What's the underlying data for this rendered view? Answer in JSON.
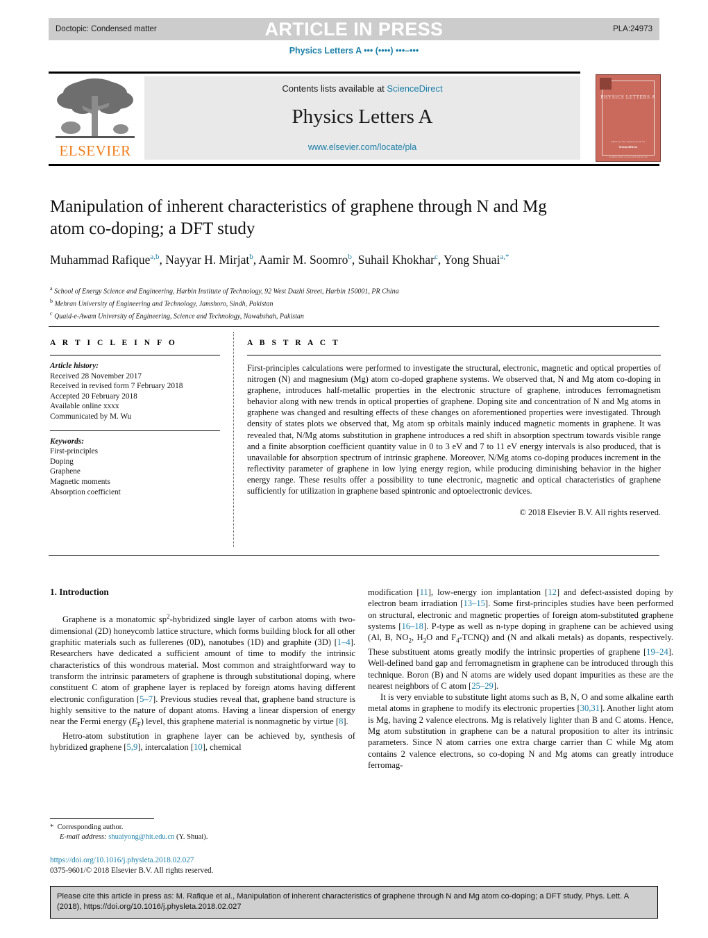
{
  "press_bar": {
    "doctopic": "Doctopic: Condensed matter",
    "status": "ARTICLE IN PRESS",
    "code": "PLA:24973"
  },
  "running_head": "Physics Letters A ••• (••••) •••–•••",
  "masthead": {
    "contents_prefix": "Contents lists available at ",
    "contents_link": "ScienceDirect",
    "journal_name": "Physics Letters A",
    "journal_url": "www.elsevier.com/locate/pla",
    "publisher_logo_text": "ELSEVIER",
    "cover": {
      "title": "PHYSICS LETTERS A",
      "foot1": "Edited by: V.M. Agranovich, M. Wu",
      "foot2": "ScienceDirect",
      "foot3": "Available online at www.sciencedirect.com"
    }
  },
  "article": {
    "title": "Manipulation of inherent characteristics of graphene through N and Mg atom co-doping; a DFT study",
    "authors": [
      {
        "name": "Muhammad Rafique",
        "marks": "a,b",
        "sep": ", "
      },
      {
        "name": "Nayyar H. Mirjat",
        "marks": "b",
        "sep": ", "
      },
      {
        "name": "Aamir M. Soomro",
        "marks": "b",
        "sep": ", "
      },
      {
        "name": "Suhail Khokhar",
        "marks": "c",
        "sep": ", "
      },
      {
        "name": "Yong Shuai",
        "marks": "a,*",
        "sep": ""
      }
    ],
    "affiliations": [
      {
        "mark": "a",
        "text": "School of Energy Science and Engineering, Harbin Institute of Technology, 92 West Dazhi Street, Harbin 150001, PR China"
      },
      {
        "mark": "b",
        "text": "Mehran University of Engineering and Technology, Jamshoro, Sindh, Pakistan"
      },
      {
        "mark": "c",
        "text": "Quaid-e-Awam University of Engineering, Science and Technology, Nawabshah, Pakistan"
      }
    ]
  },
  "info": {
    "heading": "A R T I C L E  I N F O",
    "history_label": "Article history:",
    "history": [
      "Received 28 November 2017",
      "Received in revised form 7 February 2018",
      "Accepted 20 February 2018",
      "Available online xxxx",
      "Communicated by M. Wu"
    ],
    "keywords_label": "Keywords:",
    "keywords": [
      "First-principles",
      "Doping",
      "Graphene",
      "Magnetic moments",
      "Absorption coefficient"
    ]
  },
  "abstract": {
    "heading": "A B S T R A C T",
    "text": "First-principles calculations were performed to investigate the structural, electronic, magnetic and optical properties of nitrogen (N) and magnesium (Mg) atom co-doped graphene systems. We observed that, N and Mg atom co-doping in graphene, introduces half-metallic properties in the electronic structure of graphene, introduces ferromagnetism behavior along with new trends in optical properties of graphene. Doping site and concentration of N and Mg atoms in graphene was changed and resulting effects of these changes on aforementioned properties were investigated. Through density of states plots we observed that, Mg atom sp orbitals mainly induced magnetic moments in graphene. It was revealed that, N/Mg atoms substitution in graphene introduces a red shift in absorption spectrum towards visible range and a finite absorption coefficient quantity value in 0 to 3 eV and 7 to 11 eV energy intervals is also produced, that is unavailable for absorption spectrum of intrinsic graphene. Moreover, N/Mg atoms co-doping produces increment in the reflectivity parameter of graphene in low lying energy region, while producing diminishing behavior in the higher energy range. These results offer a possibility to tune electronic, magnetic and optical characteristics of graphene sufficiently for utilization in graphene based spintronic and optoelectronic devices.",
    "copyright": "© 2018 Elsevier B.V. All rights reserved."
  },
  "body": {
    "section_heading": "1. Introduction",
    "left_paragraphs": [
      "Graphene is a monatomic sp<sup class=\"inl\">2</sup>-hybridized single layer of carbon atoms with two-dimensional (2D) honeycomb lattice structure, which forms building block for all other graphitic materials such as fullerenes (0D), nanotubes (1D) and graphite (3D) [<span class=\"ref\">1–4</span>]. Researchers have dedicated a sufficient amount of time to modify the intrinsic characteristics of this wondrous material. Most common and straightforward way to transform the intrinsic parameters of graphene is through substitutional doping, where constituent C atom of graphene layer is replaced by foreign atoms having different electronic configuration [<span class=\"ref\">5–7</span>]. Previous studies reveal that, graphene band structure is highly sensitive to the nature of dopant atoms. Having a linear dispersion of energy near the Fermi energy (<i>E</i><sub>F</sub>) level, this graphene material is nonmagnetic by virtue [<span class=\"ref\">8</span>].",
      "Hetro-atom substitution in graphene layer can be achieved by, synthesis of hybridized graphene [<span class=\"ref\">5,9</span>], intercalation [<span class=\"ref\">10</span>], chemical"
    ],
    "right_paragraphs": [
      "modification [<span class=\"ref\">11</span>], low-energy ion implantation [<span class=\"ref\">12</span>] and defect-assisted doping by electron beam irradiation [<span class=\"ref\">13–15</span>]. Some first-principles studies have been performed on structural, electronic and magnetic properties of foreign atom-substituted graphene systems [<span class=\"ref\">16–18</span>]. P-type as well as n-type doping in graphene can be achieved using (Al, B, NO<sub>2</sub>, H<sub>2</sub>O and F<sub>4</sub>-TCNQ) and (N and alkali metals) as dopants, respectively. These substituent atoms greatly modify the intrinsic properties of graphene [<span class=\"ref\">19–24</span>]. Well-defined band gap and ferromagnetism in graphene can be introduced through this technique. Boron (B) and N atoms are widely used dopant impurities as these are the nearest neighbors of C atom [<span class=\"ref\">25–29</span>].",
      "It is very enviable to substitute light atoms such as B, N, O and some alkaline earth metal atoms in graphene to modify its electronic properties [<span class=\"ref\">30,31</span>]. Another light atom is Mg, having 2 valence electrons. Mg is relatively lighter than B and C atoms. Hence, Mg atom substitution in graphene can be a natural proposition to alter its intrinsic parameters. Since N atom carries one extra charge carrier than C while Mg atom contains 2 valence electrons, so co-doping N and Mg atoms can greatly introduce ferromag-"
    ]
  },
  "footnote": {
    "star": "*",
    "corresponding": "Corresponding author.",
    "email_label": "E-mail address:",
    "email": "shuaiyong@hit.edu.cn",
    "email_owner": "(Y. Shuai).",
    "doi": "https://doi.org/10.1016/j.physleta.2018.02.027",
    "issn_line": "0375-9601/© 2018 Elsevier B.V. All rights reserved."
  },
  "cite_box": {
    "text": "Please cite this article in press as: M. Rafique et al., Manipulation of inherent characteristics of graphene through N and Mg atom co-doping; a DFT study, Phys. Lett. A (2018), https://doi.org/10.1016/j.physleta.2018.02.027"
  },
  "colors": {
    "link": "#1a7fa8",
    "press_bar_bg": "#cccccc",
    "masthead_bg": "#e9e9e9",
    "cite_box_bg": "#cfcfcf",
    "elsevier_orange": "#ef7d1a",
    "cover_red": "#c96a5c"
  }
}
